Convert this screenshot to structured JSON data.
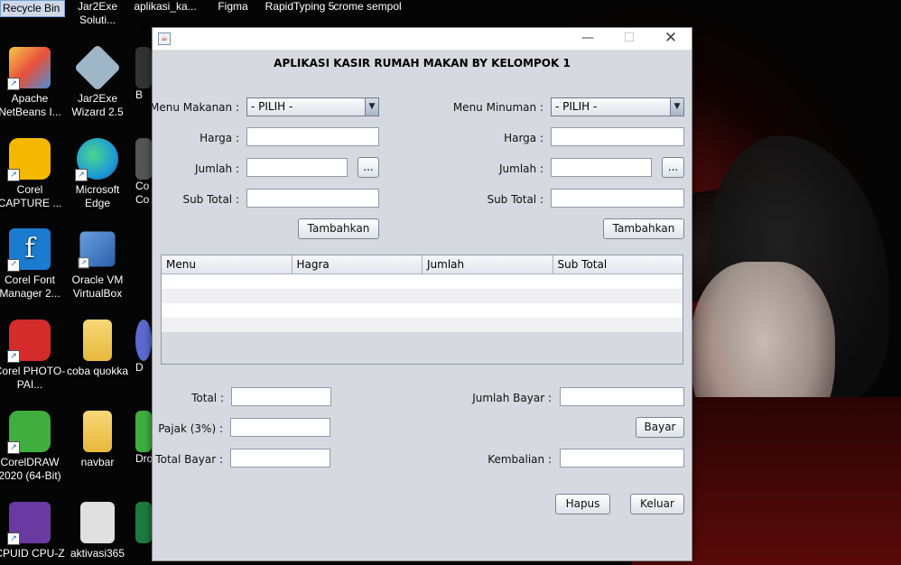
{
  "desktop": {
    "top_icons": [
      "Recycle Bin",
      "Jar2Exe Soluti...",
      "aplikasi_ka...",
      "Figma",
      "RapidTyping 5",
      "crome sempol"
    ],
    "icons": [
      {
        "label": "Apache NetBeans I...",
        "icon": "netbeans-icon",
        "color": "#e8503a"
      },
      {
        "label": "Jar2Exe Wizard 2.5",
        "icon": "jar2exe-icon",
        "color": "#9fb5c8"
      },
      {
        "label": "Corel CAPTURE ...",
        "icon": "corel-capture-icon",
        "color": "#f5b800"
      },
      {
        "label": "Microsoft Edge",
        "icon": "edge-icon",
        "color": "#1f9bd6"
      },
      {
        "label": "Corel Font Manager 2...",
        "icon": "corel-font-icon",
        "color": "#1a7bd0"
      },
      {
        "label": "Oracle VM VirtualBox",
        "icon": "virtualbox-icon",
        "color": "#2a5fa8"
      },
      {
        "label": "Corel PHOTO-PAI...",
        "icon": "corel-photo-icon",
        "color": "#d42b2b"
      },
      {
        "label": "coba quokka",
        "icon": "folder-icon",
        "color": "#f0c24a"
      },
      {
        "label": "CorelDRAW 2020 (64-Bit)",
        "icon": "coreldraw-icon",
        "color": "#3fae3f"
      },
      {
        "label": "navbar",
        "icon": "folder-icon",
        "color": "#f0c24a"
      },
      {
        "label": "CPUID CPU-Z",
        "icon": "cpuz-icon",
        "color": "#6a3aa0"
      },
      {
        "label": "aktivasi365",
        "icon": "settings-file-icon",
        "color": "#e0e0e0"
      }
    ],
    "partial_labels": [
      "B",
      "Co Co",
      "D",
      "Dro"
    ]
  },
  "window": {
    "app_title": "APLIKASI KASIR RUMAH MAKAN BY KELOMPOK 1",
    "left": {
      "menu_label": "Menu Makanan :",
      "menu_value": "- PILIH -",
      "harga_label": "Harga :",
      "jumlah_label": "Jumlah :",
      "subtotal_label": "Sub Total :",
      "dots_label": "...",
      "add_label": "Tambahkan"
    },
    "right": {
      "menu_label": "Menu Minuman :",
      "menu_value": "- PILIH -",
      "harga_label": "Harga :",
      "jumlah_label": "Jumlah :",
      "subtotal_label": "Sub Total :",
      "dots_label": "...",
      "add_label": "Tambahkan"
    },
    "table": {
      "columns": [
        "Menu",
        "Hagra",
        "Jumlah",
        "Sub Total"
      ]
    },
    "bottom": {
      "total_label": "Total :",
      "pajak_label": "Pajak (3%) :",
      "total_bayar_label": "Total Bayar :",
      "jumlah_bayar_label": "Jumlah Bayar :",
      "bayar_label": "Bayar",
      "kembalian_label": "Kembalian :",
      "hapus_label": "Hapus",
      "keluar_label": "Keluar"
    },
    "controls": {
      "minimize": "—",
      "maximize": "☐",
      "close": "✕"
    }
  }
}
